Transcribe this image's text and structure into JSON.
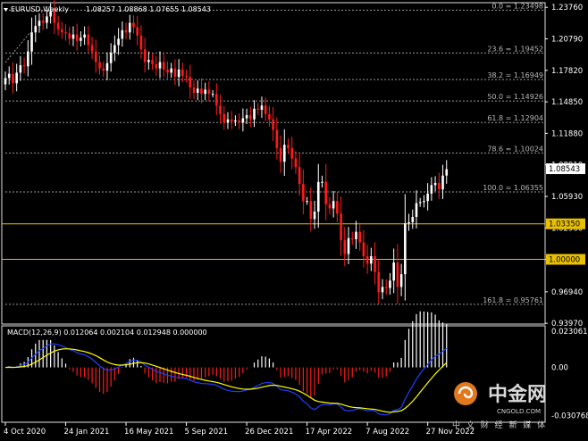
{
  "header": {
    "title": "EURUSD,Weekly",
    "ohlc": "1.08257 1.08868 1.07655 1.08543"
  },
  "macd_header": "MACD(12,26,9) 0.012064 0.002104 0.012948 0.000000",
  "watermark": {
    "name": "中金网",
    "tagline": "中 文 财 经 新 媒 体",
    "url": "CNGOLD.COM"
  },
  "colors": {
    "bull": "#ffffff",
    "bear": "#ff1a1a",
    "fib_line": "#9a9a9a",
    "level_line": "#e8c000",
    "macd_line": "#1e40ff",
    "signal_line": "#ffff00"
  },
  "chart_data": [
    {
      "type": "candlestick",
      "title": "EURUSD,Weekly",
      "ylim": [
        0.939,
        1.242
      ],
      "y_ticks": [
        "1.23760",
        "1.20790",
        "1.17820",
        "1.14850",
        "1.11880",
        "1.08910",
        "1.05930",
        "1.02960",
        "0.99990",
        "0.96940",
        "0.93970"
      ],
      "x_labels": [
        "4 Oct 2020",
        "24 Jan 2021",
        "16 May 2021",
        "5 Sep 2021",
        "26 Dec 2021",
        "17 Apr 2022",
        "7 Aug 2022",
        "27 Nov 2022"
      ],
      "x_label_weeks": [
        0,
        16,
        32,
        48,
        64,
        80,
        96,
        112
      ],
      "last_price": "1.08543",
      "price_tags": [
        {
          "label": "1.08543",
          "value": 1.08543,
          "style": "white"
        },
        {
          "label": "1.03350",
          "value": 1.0335,
          "style": "yellow"
        },
        {
          "label": "1.00000",
          "value": 1.0,
          "style": "yellow"
        }
      ],
      "fibonacci_levels": [
        {
          "label": "0.0 = 1.23498",
          "value": 1.23498
        },
        {
          "label": "23.6 = 1.19452",
          "value": 1.19452
        },
        {
          "label": "38.2 = 1.16949",
          "value": 1.16949
        },
        {
          "label": "50.0 = 1.14926",
          "value": 1.14926
        },
        {
          "label": "61.8 = 1.12904",
          "value": 1.12904
        },
        {
          "label": "78.6 = 1.10024",
          "value": 1.10024
        },
        {
          "label": "100.0 = 1.06355",
          "value": 1.06355
        },
        {
          "label": "161.8 = 0.95761",
          "value": 0.95761
        }
      ],
      "horizontal_levels": [
        1.0335,
        1.0
      ],
      "closes": [
        1.171,
        1.175,
        1.166,
        1.176,
        1.183,
        1.182,
        1.196,
        1.214,
        1.22,
        1.225,
        1.223,
        1.229,
        1.234,
        1.223,
        1.217,
        1.214,
        1.213,
        1.208,
        1.212,
        1.206,
        1.209,
        1.212,
        1.202,
        1.196,
        1.186,
        1.18,
        1.178,
        1.185,
        1.195,
        1.202,
        1.208,
        1.216,
        1.214,
        1.223,
        1.219,
        1.211,
        1.198,
        1.186,
        1.188,
        1.184,
        1.18,
        1.186,
        1.179,
        1.176,
        1.18,
        1.172,
        1.179,
        1.173,
        1.172,
        1.162,
        1.157,
        1.161,
        1.156,
        1.16,
        1.156,
        1.156,
        1.145,
        1.137,
        1.129,
        1.132,
        1.13,
        1.131,
        1.129,
        1.133,
        1.136,
        1.132,
        1.142,
        1.141,
        1.145,
        1.137,
        1.132,
        1.122,
        1.105,
        1.092,
        1.108,
        1.105,
        1.095,
        1.087,
        1.071,
        1.055,
        1.055,
        1.038,
        1.045,
        1.073,
        1.073,
        1.052,
        1.048,
        1.055,
        1.043,
        1.018,
        1.005,
        1.02,
        1.019,
        1.026,
        1.016,
        1.003,
        0.996,
        1.003,
        0.988,
        0.969,
        0.974,
        0.973,
        0.98,
        0.997,
        0.974,
        0.986,
        1.034,
        1.035,
        1.04,
        1.053,
        1.054,
        1.055,
        1.062,
        1.07,
        1.072,
        1.066,
        1.079,
        1.085
      ],
      "open": 1.165
    },
    {
      "type": "macd",
      "title": "MACD(12,26,9)",
      "values": {
        "macd": 0.012064,
        "signal": 0.002104,
        "histogram": 0.012948,
        "extra": 0.0
      },
      "ylim": [
        -0.0345,
        0.026
      ],
      "y_ticks": [
        "0.023061",
        "0.00",
        "-0.030768"
      ]
    }
  ]
}
